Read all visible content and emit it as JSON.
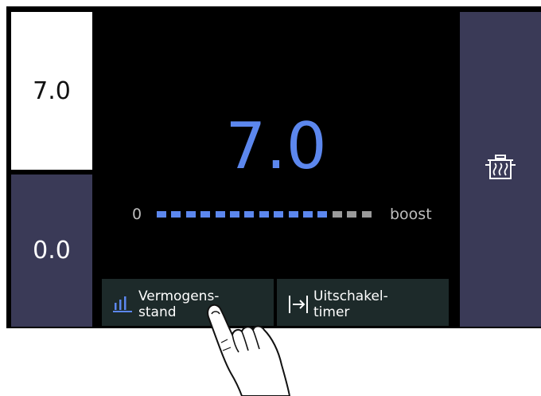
{
  "zones": {
    "front_value": "7.0",
    "rear_value": "0.0"
  },
  "main": {
    "power_value": "7.0",
    "scale_min_label": "0",
    "scale_max_label": "boost",
    "level_fraction": 0.8,
    "segment_count": 15,
    "active_color": "#5c87ee",
    "inactive_color": "#9a9a9a"
  },
  "buttons": {
    "power_level": {
      "line1": "Vermogens-",
      "line2": "stand",
      "icon": "bar-chart-icon"
    },
    "shutoff_timer": {
      "line1": "Uitschakel-",
      "line2": "timer",
      "icon": "arrow-to-bar-icon"
    }
  },
  "side": {
    "icon": "cooking-pot-icon"
  },
  "colors": {
    "panel_bg": "#3a3a57",
    "accent": "#5c87ee",
    "button_bg": "#1d2a2a"
  }
}
